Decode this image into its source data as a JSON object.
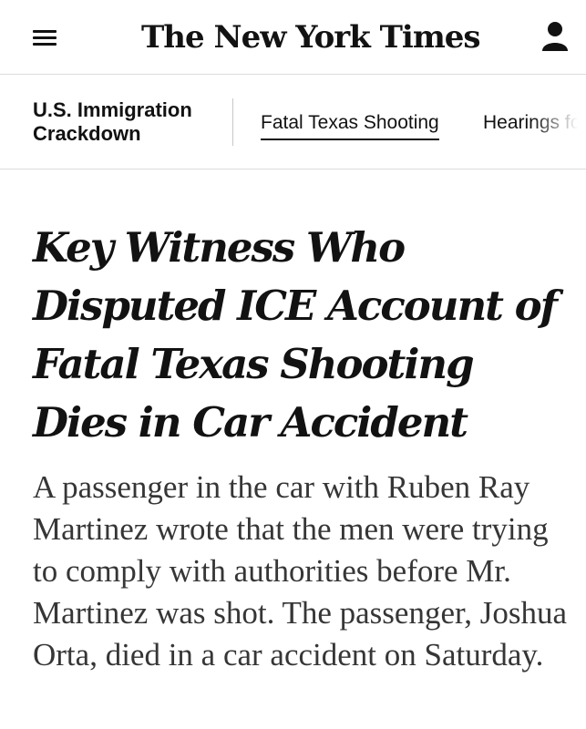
{
  "header": {
    "logo_text": "The New York Times",
    "menu_icon": "hamburger-menu-icon",
    "account_icon": "user-account-icon"
  },
  "subnav": {
    "section_label": "U.S. Immigration Crackdown",
    "links": [
      {
        "label": "Fatal Texas Shooting",
        "active": true
      },
      {
        "label": "Hearings fo",
        "active": false
      }
    ]
  },
  "article": {
    "headline": "Key Witness Who Disputed ICE Account of Fatal Texas Shooting Dies in Car Accident",
    "summary": "A passenger in the car with Ruben Ray Martinez wrote that the men were trying to comply with authorities before Mr. Martinez was shot. The passenger, Joshua Orta, died in a car accident on Saturday."
  },
  "colors": {
    "text": "#121212",
    "summary_text": "#363636",
    "divider": "#dcdcdc"
  }
}
